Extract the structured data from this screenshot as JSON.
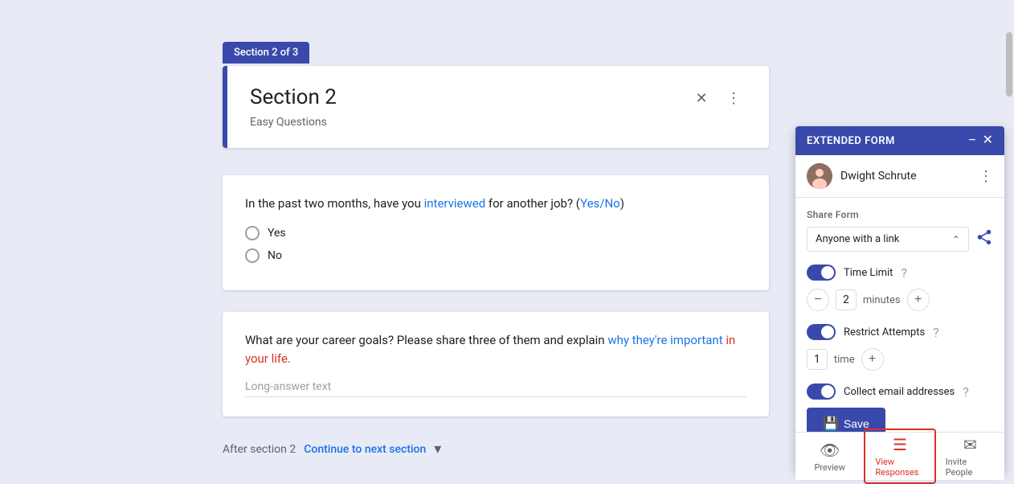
{
  "page": {
    "background_color": "#e8eaf6"
  },
  "section_badge": {
    "label": "Section 2 of 3"
  },
  "section_card": {
    "title": "Section 2",
    "subtitle": "Easy Questions",
    "collapse_icon": "✕",
    "more_icon": "⋮"
  },
  "question1": {
    "text_parts": [
      {
        "text": "In the past two months, have you ",
        "style": "normal"
      },
      {
        "text": "interviewed",
        "style": "green"
      },
      {
        "text": " for another job? (",
        "style": "normal"
      },
      {
        "text": "Yes/No",
        "style": "blue"
      },
      {
        "text": ")",
        "style": "normal"
      }
    ],
    "full_text": "In the past two months, have you interviewed for another job? (Yes/No)",
    "options": [
      "Yes",
      "No"
    ]
  },
  "question2": {
    "full_text": "What are your career goals? Please share three of them and explain why they're important in your life.",
    "placeholder": "Long-answer text"
  },
  "after_section": {
    "label": "After section 2",
    "action": "Continue to next section"
  },
  "extended_panel": {
    "title": "EXTENDED FORM",
    "minimize_icon": "−",
    "close_icon": "✕",
    "user": {
      "name": "Dwight Schrute",
      "more_icon": "⋮"
    },
    "share_form": {
      "label": "Share Form",
      "selected": "Anyone with a link",
      "dropdown_icon": "⌄",
      "share_icon": "↗"
    },
    "time_limit": {
      "label": "Time Limit",
      "enabled": true,
      "value": "2",
      "unit": "minutes",
      "help_icon": "?"
    },
    "restrict_attempts": {
      "label": "Restrict Attempts",
      "enabled": true,
      "value": "1",
      "unit": "time",
      "help_icon": "?"
    },
    "collect_email": {
      "label": "Collect email addresses",
      "enabled": true,
      "help_icon": "?"
    },
    "save_button": "Save"
  },
  "bottom_bar": {
    "items": [
      {
        "label": "Preview",
        "icon": "👁",
        "active": false,
        "name": "preview"
      },
      {
        "label": "View Responses",
        "icon": "☰",
        "active": true,
        "name": "view-responses"
      },
      {
        "label": "Invite People",
        "icon": "✉",
        "active": false,
        "name": "invite-people"
      }
    ]
  }
}
